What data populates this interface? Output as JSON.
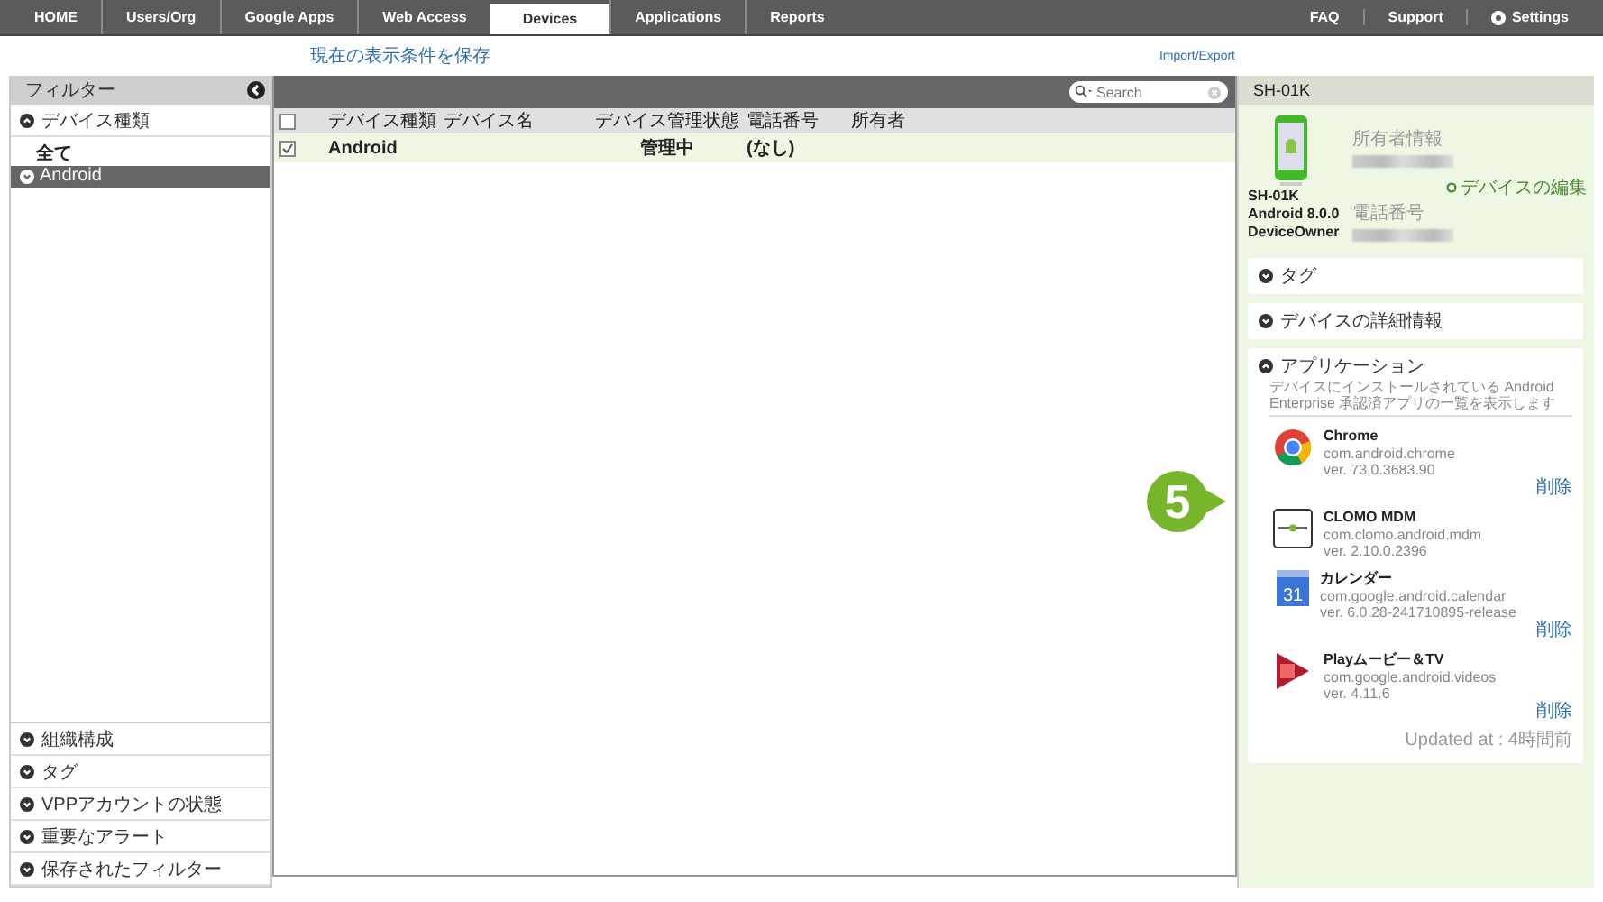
{
  "nav": {
    "tabs": [
      {
        "label": "HOME",
        "selected": false
      },
      {
        "label": "Users/Org",
        "selected": false
      },
      {
        "label": "Google Apps",
        "selected": false
      },
      {
        "label": "Web Access",
        "selected": false
      },
      {
        "label": "Devices",
        "selected": true
      },
      {
        "label": "Applications",
        "selected": false
      },
      {
        "label": "Reports",
        "selected": false
      }
    ],
    "right_links": [
      {
        "label": "FAQ",
        "kind": "text"
      },
      {
        "label": "Support",
        "kind": "text"
      },
      {
        "label": "Settings",
        "kind": "gear"
      }
    ]
  },
  "save_view_link": "現在の表示条件を保存",
  "import_export_link": "Import/Export",
  "sidebar": {
    "title": "フィルター",
    "top_sections": [
      {
        "label": "デバイス種類",
        "expanded": true,
        "options": [
          {
            "label": "全て",
            "selected": false
          },
          {
            "label": "Android",
            "selected": true
          }
        ]
      }
    ],
    "bottom_sections": [
      {
        "label": "組織構成",
        "expanded": false
      },
      {
        "label": "タグ",
        "expanded": false
      },
      {
        "label": "VPPアカウントの状態",
        "expanded": false
      },
      {
        "label": "重要なアラート",
        "expanded": false
      },
      {
        "label": "保存されたフィルター",
        "expanded": false
      }
    ]
  },
  "table": {
    "search": {
      "placeholder": "Search"
    },
    "header_checked": false,
    "columns": [
      "デバイス種類",
      "デバイス名",
      "デバイス管理状態",
      "電話番号",
      "所有者"
    ],
    "rows": [
      {
        "checked": true,
        "cells": [
          "Android",
          "",
          "管理中",
          "(なし)",
          ""
        ]
      }
    ]
  },
  "detail": {
    "title": "SH-01K",
    "device_lines": [
      "SH-01K",
      "Android 8.0.0",
      "DeviceOwner"
    ],
    "owner_label": "所有者情報",
    "phone_label": "電話番号",
    "edit_link": "デバイスの編集",
    "sections": [
      {
        "label": "タグ",
        "expanded": false
      },
      {
        "label": "デバイスの詳細情報",
        "expanded": false
      },
      {
        "label": "アプリケーション",
        "expanded": true,
        "description": "デバイスにインストールされている Android Enterprise 承認済アプリの一覧を表示します",
        "apps": [
          {
            "kind": "chrome",
            "name": "Chrome",
            "package": "com.android.chrome",
            "version": "ver. 73.0.3683.90",
            "delete": "削除"
          },
          {
            "kind": "clomo",
            "name": "CLOMO MDM",
            "package": "com.clomo.android.mdm",
            "version": "ver. 2.10.0.2396"
          },
          {
            "kind": "calendar",
            "icon_text": "31",
            "name": "カレンダー",
            "package": "com.google.android.calendar",
            "version": "ver. 6.0.28-241710895-release",
            "delete": "削除"
          },
          {
            "kind": "video",
            "name": "Playムービー＆TV",
            "package": "com.google.android.videos",
            "version": "ver. 4.11.6",
            "delete": "削除"
          }
        ],
        "updated": "Updated at : 4時間前"
      }
    ]
  },
  "callout": "5"
}
